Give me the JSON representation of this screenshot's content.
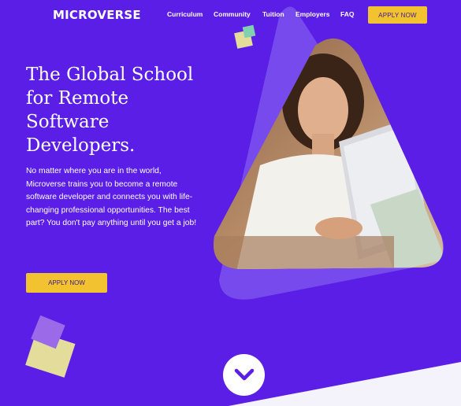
{
  "brand": {
    "logo_text": "MICROVERSE"
  },
  "nav": {
    "items": [
      {
        "label": "Curriculum"
      },
      {
        "label": "Community"
      },
      {
        "label": "Tuition"
      },
      {
        "label": "Employers"
      },
      {
        "label": "FAQ"
      }
    ],
    "apply_label": "APPLY NOW"
  },
  "hero": {
    "headline_lines": [
      "The Global School",
      "for Remote",
      "Software",
      "Developers."
    ],
    "description": "No matter where you are in the world, Microverse trains you to become a remote software developer and connects you with life-changing professional opportunities. The best part? You don't pay anything until you get a job!",
    "apply_label": "APPLY NOW"
  },
  "icons": {
    "scroll_down": "chevron-down-icon"
  },
  "colors": {
    "background": "#5a1ee6",
    "accent_button": "#f2c230",
    "button_text": "#3b1a8a",
    "triangle": "#7b52ec",
    "deco_yellow": "#e3dc9a",
    "deco_purple": "#9a6ae8",
    "deco_green": "#7fd1b0",
    "wave": "#f4f2fb"
  }
}
